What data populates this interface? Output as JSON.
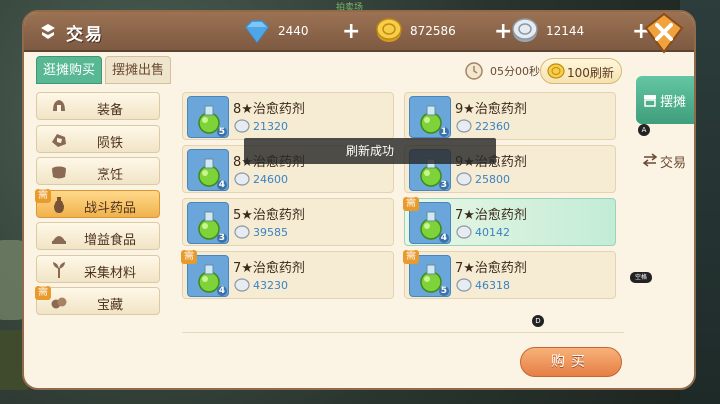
{
  "header": {
    "title": "交易",
    "overlay_text": "拍卖场"
  },
  "resources": [
    {
      "icon": "diamond-icon",
      "value": "2440"
    },
    {
      "icon": "gold-coin-icon",
      "value": "872586"
    },
    {
      "icon": "silver-coin-icon",
      "value": "12144"
    }
  ],
  "tabs": [
    {
      "label": "逛摊购买",
      "active": true
    },
    {
      "label": "摆摊出售",
      "active": false
    }
  ],
  "timer": {
    "text": "05分00秒"
  },
  "refresh": {
    "label": "100刷新"
  },
  "categories": [
    {
      "label": "装备",
      "icon": "helmet-icon",
      "badge": ""
    },
    {
      "label": "陨铁",
      "icon": "ore-icon",
      "badge": ""
    },
    {
      "label": "烹饪",
      "icon": "cooking-pot-icon",
      "badge": ""
    },
    {
      "label": "战斗药品",
      "icon": "potion-bottle-icon",
      "badge": "需",
      "active": true
    },
    {
      "label": "增益食品",
      "icon": "food-icon",
      "badge": ""
    },
    {
      "label": "采集材料",
      "icon": "herb-icon",
      "badge": ""
    },
    {
      "label": "宝藏",
      "icon": "treasure-icon",
      "badge": "需"
    }
  ],
  "items": [
    {
      "name": "8★治愈药剂",
      "price": "21320",
      "qty": "5",
      "badge": ""
    },
    {
      "name": "9★治愈药剂",
      "price": "22360",
      "qty": "1",
      "badge": ""
    },
    {
      "name": "8★治愈药剂",
      "price": "24600",
      "qty": "4",
      "badge": ""
    },
    {
      "name": "9★治愈药剂",
      "price": "25800",
      "qty": "3",
      "badge": ""
    },
    {
      "name": "5★治愈药剂",
      "price": "39585",
      "qty": "3",
      "badge": ""
    },
    {
      "name": "7★治愈药剂",
      "price": "40142",
      "qty": "4",
      "badge": "需",
      "selected": true
    },
    {
      "name": "7★治愈药剂",
      "price": "43230",
      "qty": "4",
      "badge": "需"
    },
    {
      "name": "7★治愈药剂",
      "price": "46318",
      "qty": "5",
      "badge": "需"
    }
  ],
  "toast": {
    "text": "刷新成功"
  },
  "buy_button": {
    "label": "购买"
  },
  "side_tabs": [
    {
      "label": "摆摊",
      "active": true
    },
    {
      "label": "交易",
      "active": false
    }
  ],
  "hints": {
    "a": "A",
    "space": "空格",
    "d": "D"
  },
  "colors": {
    "accent_green": "#58b894",
    "buy_orange": "#e57f45",
    "price_blue": "#3b82c4",
    "badge_orange": "#e89a2a"
  }
}
